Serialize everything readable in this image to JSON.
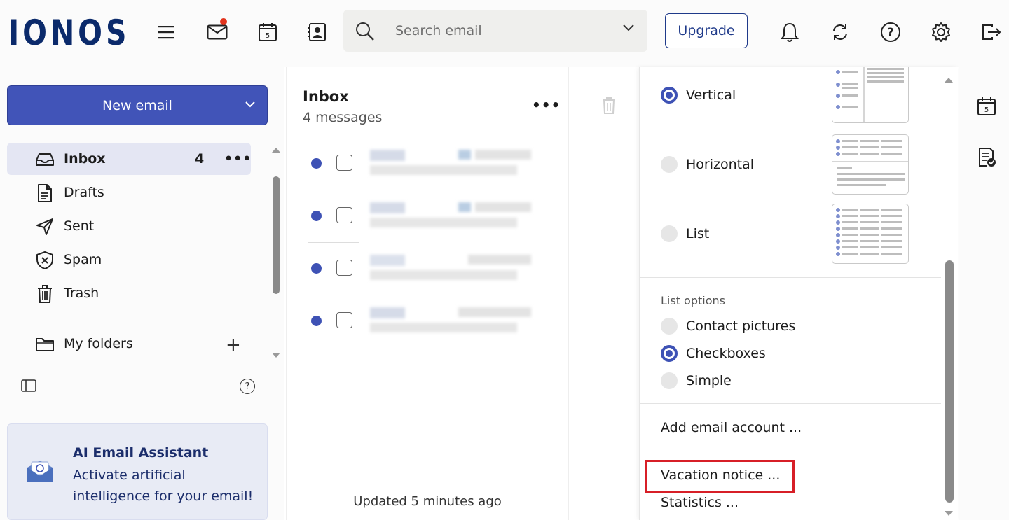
{
  "header": {
    "logo": "IONOS",
    "calendar_day": "5",
    "search": {
      "placeholder": "Search email"
    },
    "upgrade_label": "Upgrade",
    "accent": "#3e52b5",
    "notification_color": "#e2341d",
    "icons": [
      "menu-icon",
      "mail-icon",
      "calendar-icon",
      "contacts-icon",
      "search-icon",
      "chevron-down-icon",
      "bell-icon",
      "sync-icon",
      "help-icon",
      "gear-icon",
      "logout-icon"
    ]
  },
  "sidebar": {
    "new_email_label": "New email",
    "folders": [
      {
        "label": "Inbox",
        "count": "4",
        "icon": "inbox-icon",
        "active": true,
        "more": "•••"
      },
      {
        "label": "Drafts",
        "icon": "document-icon"
      },
      {
        "label": "Sent",
        "icon": "send-icon"
      },
      {
        "label": "Spam",
        "icon": "shield-icon"
      },
      {
        "label": "Trash",
        "icon": "trash-icon"
      }
    ],
    "my_folders_label": "My folders",
    "add_folder_label": "+",
    "help_label": "?",
    "ai_card": {
      "title": "AI Email Assistant",
      "description": "Activate artificial intelligence for your email!"
    }
  },
  "message_list": {
    "title": "Inbox",
    "subtitle": "4 messages",
    "more_label": "•••",
    "messages": [
      {
        "unread": true,
        "checked": false
      },
      {
        "unread": true,
        "checked": false
      },
      {
        "unread": true,
        "checked": false
      },
      {
        "unread": true,
        "checked": false
      }
    ],
    "updated": "Updated 5 minutes ago"
  },
  "view_panel": {
    "layout_options": [
      {
        "label": "Vertical",
        "selected": true
      },
      {
        "label": "Horizontal",
        "selected": false
      },
      {
        "label": "List",
        "selected": false
      }
    ],
    "list_options_title": "List options",
    "list_options": [
      {
        "label": "Contact pictures",
        "selected": false
      },
      {
        "label": "Checkboxes",
        "selected": true
      },
      {
        "label": "Simple",
        "selected": false
      }
    ],
    "add_account": "Add email account ...",
    "vacation_notice": "Vacation notice ...",
    "statistics": "Statistics ...",
    "highlight_color": "#d71f27"
  },
  "right_rail": {
    "calendar_day": "5",
    "icons": [
      "calendar-icon",
      "tasks-icon"
    ]
  }
}
